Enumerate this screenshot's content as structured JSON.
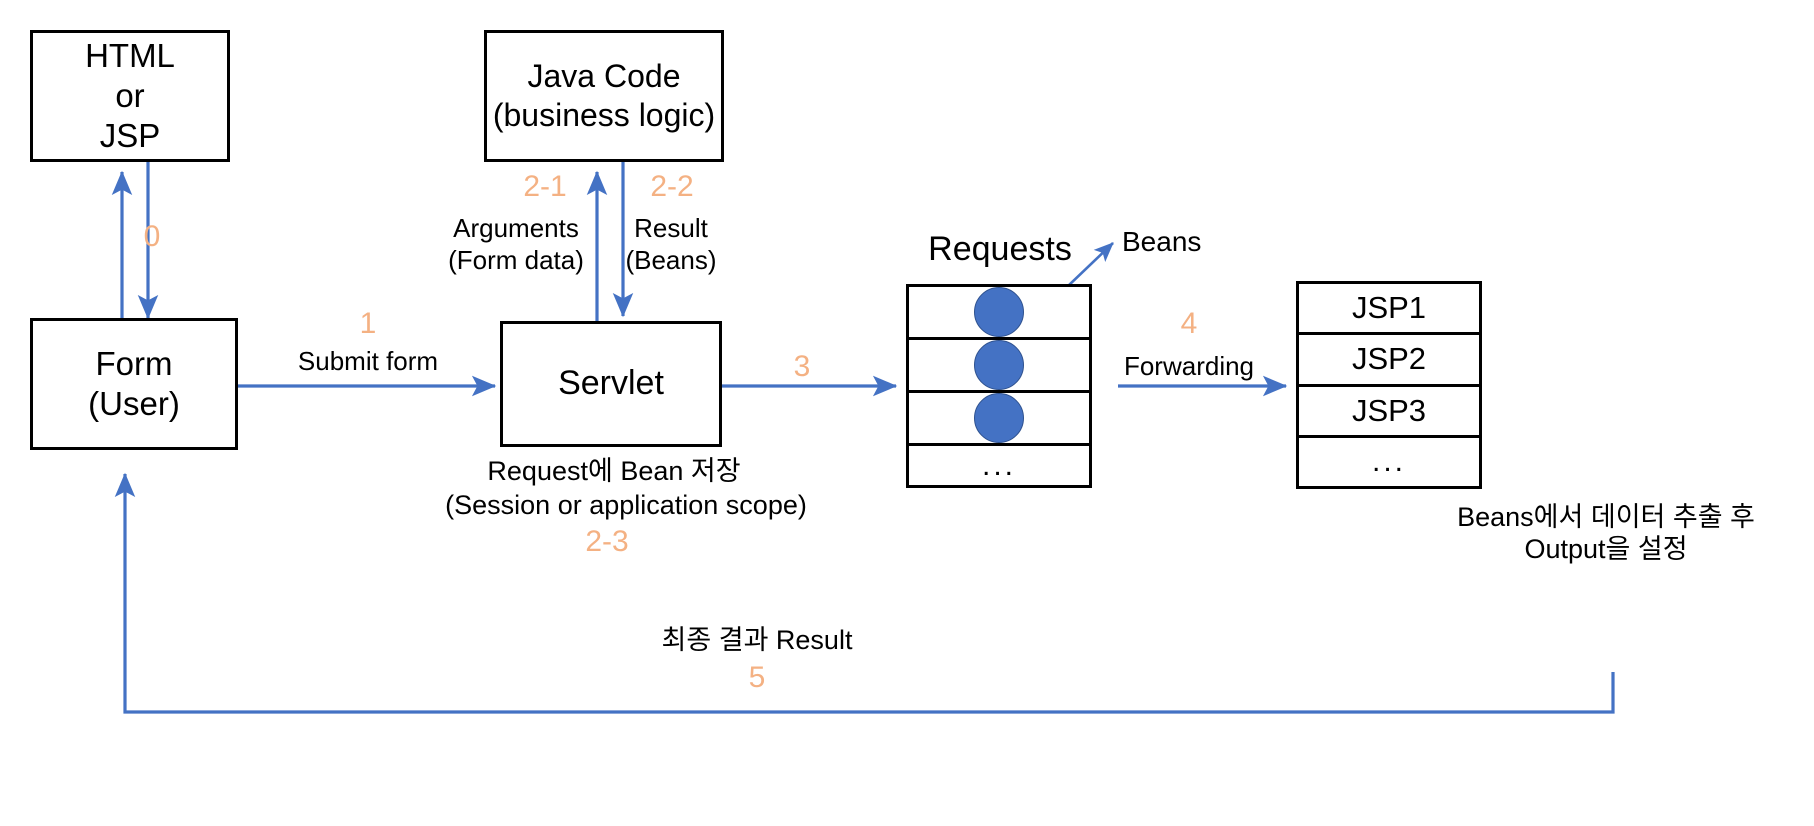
{
  "diagram": {
    "title": "JSP/Servlet MVC request flow",
    "colors": {
      "arrow": "#4472C4",
      "step_number": "#F4B183",
      "bean_fill": "#4472C4",
      "box_border": "#000000"
    },
    "boxes": {
      "html_or_jsp": {
        "line1": "HTML",
        "line2": "or",
        "line3": "JSP"
      },
      "java_code": {
        "line1": "Java Code",
        "line2": "(business logic)"
      },
      "form_user": {
        "line1": "Form",
        "line2": "(User)"
      },
      "servlet": {
        "line1": "Servlet"
      }
    },
    "tables": {
      "requests": {
        "header": "Requests",
        "rows": [
          {
            "type": "bean",
            "label": ""
          },
          {
            "type": "bean",
            "label": ""
          },
          {
            "type": "bean",
            "label": ""
          },
          {
            "type": "text",
            "label": "..."
          }
        ]
      },
      "jsp": {
        "rows": [
          {
            "label": "JSP1"
          },
          {
            "label": "JSP2"
          },
          {
            "label": "JSP3"
          },
          {
            "label": "..."
          }
        ]
      }
    },
    "annotations": {
      "beans_callout": "Beans",
      "servlet_caption_line1": "Request에 Bean 저장",
      "servlet_caption_line2": "(Session or application scope)",
      "jsp_caption_line1": "Beans에서 데이터 추출 후",
      "jsp_caption_line2": "Output을 설정",
      "final_result": "최종 결과 Result"
    },
    "flows": [
      {
        "step": "0",
        "label": "",
        "from": "form_user",
        "to": "html_or_jsp"
      },
      {
        "step": "1",
        "label": "Submit form",
        "from": "form_user",
        "to": "servlet"
      },
      {
        "step": "2-1",
        "label_line1": "Arguments",
        "label_line2": "(Form data)",
        "from": "servlet",
        "to": "java_code"
      },
      {
        "step": "2-2",
        "label_line1": "Result",
        "label_line2": "(Beans)",
        "from": "java_code",
        "to": "servlet"
      },
      {
        "step": "2-3",
        "label": "",
        "from": "servlet",
        "to": "requests"
      },
      {
        "step": "3",
        "label": "",
        "from": "servlet",
        "to": "requests"
      },
      {
        "step": "4",
        "label": "Forwarding",
        "from": "requests",
        "to": "jsp"
      },
      {
        "step": "5",
        "label": "최종 결과 Result",
        "from": "jsp",
        "to": "form_user"
      }
    ],
    "steps": {
      "s0": "0",
      "s1": "1",
      "s21": "2-1",
      "s22": "2-2",
      "s23": "2-3",
      "s3": "3",
      "s4": "4",
      "s5": "5"
    },
    "labels": {
      "submit_form": "Submit form",
      "arguments": "Arguments",
      "form_data": "(Form data)",
      "result": "Result",
      "beans_paren": "(Beans)",
      "forwarding": "Forwarding"
    }
  }
}
